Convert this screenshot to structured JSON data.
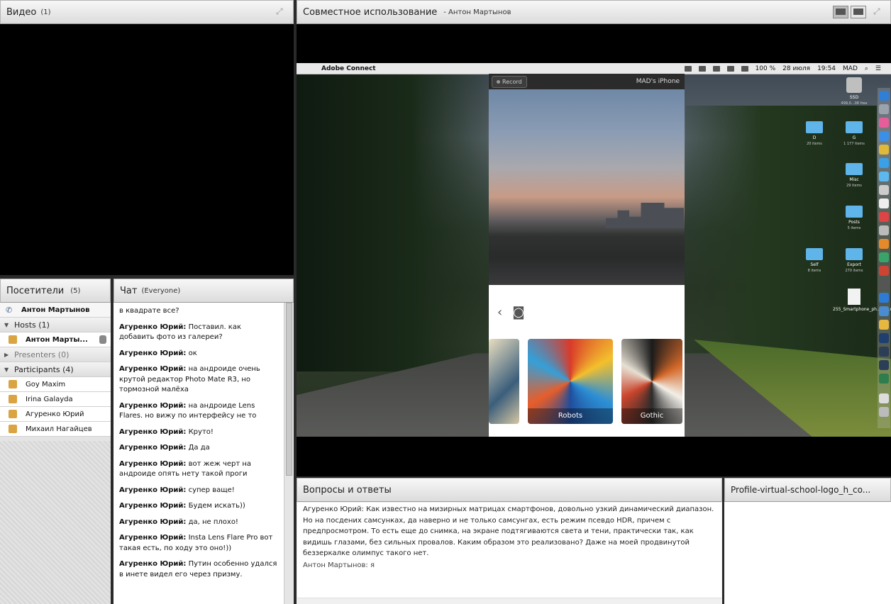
{
  "video": {
    "title": "Видео",
    "count": "(1)"
  },
  "share": {
    "title": "Совместное использование",
    "presenter": "- Антон Мартынов",
    "mac_menubar": {
      "app": "Adobe Connect",
      "battery": "100 %",
      "date": "28 июля",
      "time": "19:54",
      "user": "MAD"
    },
    "phone": {
      "record_label": "Record",
      "device_name": "MAD's iPhone",
      "filters": [
        "Robots",
        "Gothic"
      ]
    },
    "desktop_icons": [
      {
        "name": "SSD",
        "sub": "499,0...08 free"
      },
      {
        "name": "D",
        "sub": "20 items"
      },
      {
        "name": "G",
        "sub": "1 177 items"
      },
      {
        "name": "Misc",
        "sub": "29 items"
      },
      {
        "name": "Posts",
        "sub": "5 items"
      },
      {
        "name": "Self",
        "sub": "8 items"
      },
      {
        "name": "Export",
        "sub": "270 items"
      },
      {
        "name": "255_Smartphone_ph...L05.md",
        "sub": ""
      }
    ]
  },
  "visitors": {
    "title": "Посетители",
    "count": "(5)",
    "me": "Антон Мартынов",
    "hosts_label": "Hosts (1)",
    "host": "Антон Марты...",
    "presenters_label": "Presenters (0)",
    "participants_label": "Participants (4)",
    "participants": [
      "Goy Maxim",
      "Irina Galayda",
      "Агуренко Юрий",
      "Михаил Нагайцев"
    ]
  },
  "chat": {
    "title": "Чат",
    "scope": "(Everyone)",
    "messages": [
      {
        "author": "",
        "text": "в квадрате все?"
      },
      {
        "author": "Агуренко Юрий:",
        "text": "Поставил. как добавить фото из галереи?"
      },
      {
        "author": "Агуренко Юрий:",
        "text": "ок"
      },
      {
        "author": "Агуренко Юрий:",
        "text": "на андроиде очень крутой редактор Photo Mate R3, но тормозной малёха"
      },
      {
        "author": "Агуренко Юрий:",
        "text": "на андроиде Lens Flares. но вижу по интерфейсу не то"
      },
      {
        "author": "Агуренко Юрий:",
        "text": "Круто!"
      },
      {
        "author": "Агуренко Юрий:",
        "text": "Да да"
      },
      {
        "author": "Агуренко Юрий:",
        "text": "вот жеж черт на андроиде опять нету такой проги"
      },
      {
        "author": "Агуренко Юрий:",
        "text": "супер ваще!"
      },
      {
        "author": "Агуренко Юрий:",
        "text": "Будем искать))"
      },
      {
        "author": "Агуренко Юрий:",
        "text": "да, не плохо!"
      },
      {
        "author": "Агуренко Юрий:",
        "text": "Insta Lens Flare Pro вот такая есть, по ходу это оно!))"
      },
      {
        "author": "Агуренко Юрий:",
        "text": "Путин особенно удался в инете видел его через призму."
      }
    ]
  },
  "qa": {
    "title": "Вопросы и ответы",
    "question": "Агуренко Юрий: Как известно на мизирных матрицах смартфонов, довольно узкий динамический диапазон. Но на посдених самсунках, да наверно и не только самсунгах, есть режим псевдо HDR, причем с предпросмотром. То есть еще до снимка, на экране подтягиваются света и тени, практически так, как видишь глазами, без сильных провалов. Каким образом это реализовано?  Даже на моей продвинутой беззеркалке олимпус такого нет.",
    "answer": "Антон Мартынов: я"
  },
  "profile": {
    "title": "Profile-virtual-school-logo_h_co..."
  }
}
